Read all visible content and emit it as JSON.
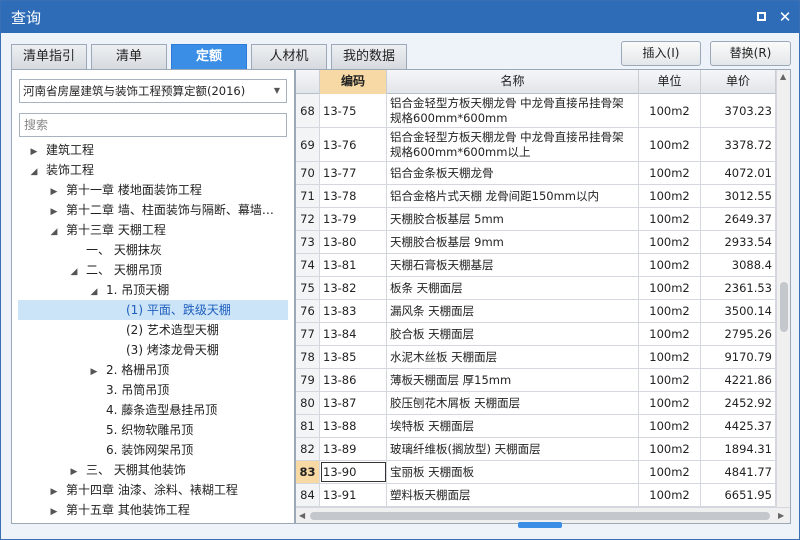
{
  "window": {
    "title": "查询"
  },
  "tabs": [
    {
      "label": "清单指引",
      "active": false
    },
    {
      "label": "清单",
      "active": false
    },
    {
      "label": "定额",
      "active": true
    },
    {
      "label": "人材机",
      "active": false
    },
    {
      "label": "我的数据",
      "active": false
    }
  ],
  "actions": {
    "insert_label": "插入(I)",
    "replace_label": "替换(R)"
  },
  "left": {
    "quota_selected": "河南省房屋建筑与装饰工程预算定额(2016)",
    "search_placeholder": "搜索",
    "tree": [
      {
        "label": "建筑工程",
        "toggle": "▶"
      },
      {
        "label": "装饰工程",
        "toggle": "◢"
      },
      {
        "label": "第十一章 楼地面装饰工程",
        "toggle": "▶"
      },
      {
        "label": "第十二章 墙、柱面装饰与隔断、幕墙…",
        "toggle": "▶"
      },
      {
        "label": "第十三章 天棚工程",
        "toggle": "◢"
      },
      {
        "label": "一、 天棚抹灰",
        "toggle": ""
      },
      {
        "label": "二、 天棚吊顶",
        "toggle": "◢"
      },
      {
        "label": "1. 吊顶天棚",
        "toggle": "◢"
      },
      {
        "label": "(1) 平面、跌级天棚",
        "toggle": "",
        "selected": true
      },
      {
        "label": "(2) 艺术造型天棚",
        "toggle": ""
      },
      {
        "label": "(3) 烤漆龙骨天棚",
        "toggle": ""
      },
      {
        "label": "2. 格栅吊顶",
        "toggle": "▶"
      },
      {
        "label": "3. 吊筒吊顶",
        "toggle": ""
      },
      {
        "label": "4. 藤条造型悬挂吊顶",
        "toggle": ""
      },
      {
        "label": "5. 织物软雕吊顶",
        "toggle": ""
      },
      {
        "label": "6. 装饰网架吊顶",
        "toggle": ""
      },
      {
        "label": "三、 天棚其他装饰",
        "toggle": "▶"
      },
      {
        "label": "第十四章 油漆、涂料、裱糊工程",
        "toggle": "▶"
      },
      {
        "label": "第十五章 其他装饰工程",
        "toggle": "▶"
      }
    ]
  },
  "grid": {
    "headers": {
      "code": "编码",
      "name": "名称",
      "unit": "单位",
      "price": "单价"
    },
    "rows": [
      {
        "num": "68",
        "code": "13-75",
        "name": "铝合金轻型方板天棚龙骨 中龙骨直接吊挂骨架 规格600mm*600mm",
        "unit": "100m2",
        "price": "3703.23"
      },
      {
        "num": "69",
        "code": "13-76",
        "name": "铝合金轻型方板天棚龙骨 中龙骨直接吊挂骨架 规格600mm*600mm以上",
        "unit": "100m2",
        "price": "3378.72"
      },
      {
        "num": "70",
        "code": "13-77",
        "name": "铝合金条板天棚龙骨",
        "unit": "100m2",
        "price": "4072.01"
      },
      {
        "num": "71",
        "code": "13-78",
        "name": "铝合金格片式天棚 龙骨间距150mm以内",
        "unit": "100m2",
        "price": "3012.55"
      },
      {
        "num": "72",
        "code": "13-79",
        "name": "天棚胶合板基层 5mm",
        "unit": "100m2",
        "price": "2649.37"
      },
      {
        "num": "73",
        "code": "13-80",
        "name": "天棚胶合板基层 9mm",
        "unit": "100m2",
        "price": "2933.54"
      },
      {
        "num": "74",
        "code": "13-81",
        "name": "天棚石膏板天棚基层",
        "unit": "100m2",
        "price": "3088.4"
      },
      {
        "num": "75",
        "code": "13-82",
        "name": "板条 天棚面层",
        "unit": "100m2",
        "price": "2361.53"
      },
      {
        "num": "76",
        "code": "13-83",
        "name": "漏风条 天棚面层",
        "unit": "100m2",
        "price": "3500.14"
      },
      {
        "num": "77",
        "code": "13-84",
        "name": "胶合板 天棚面层",
        "unit": "100m2",
        "price": "2795.26"
      },
      {
        "num": "78",
        "code": "13-85",
        "name": "水泥木丝板 天棚面层",
        "unit": "100m2",
        "price": "9170.79"
      },
      {
        "num": "79",
        "code": "13-86",
        "name": "薄板天棚面层 厚15mm",
        "unit": "100m2",
        "price": "4221.86"
      },
      {
        "num": "80",
        "code": "13-87",
        "name": "胶压刨花木屑板 天棚面层",
        "unit": "100m2",
        "price": "2452.92"
      },
      {
        "num": "81",
        "code": "13-88",
        "name": "埃特板 天棚面层",
        "unit": "100m2",
        "price": "4425.37"
      },
      {
        "num": "82",
        "code": "13-89",
        "name": "玻璃纤维板(搁放型) 天棚面层",
        "unit": "100m2",
        "price": "1894.31"
      },
      {
        "num": "83",
        "code": "13-90",
        "name": "宝丽板 天棚面板",
        "unit": "100m2",
        "price": "4841.77",
        "current": true
      },
      {
        "num": "84",
        "code": "13-91",
        "name": "塑料板天棚面层",
        "unit": "100m2",
        "price": "6651.95"
      }
    ]
  },
  "colors": {
    "titlebar": "#2f6cb8",
    "active_tab": "#3a8ee6",
    "selected_tree": "#cce4f7",
    "current_row": "#f7d9a3"
  },
  "icons": {
    "maximize": "maximize-icon",
    "close": "close-icon"
  }
}
